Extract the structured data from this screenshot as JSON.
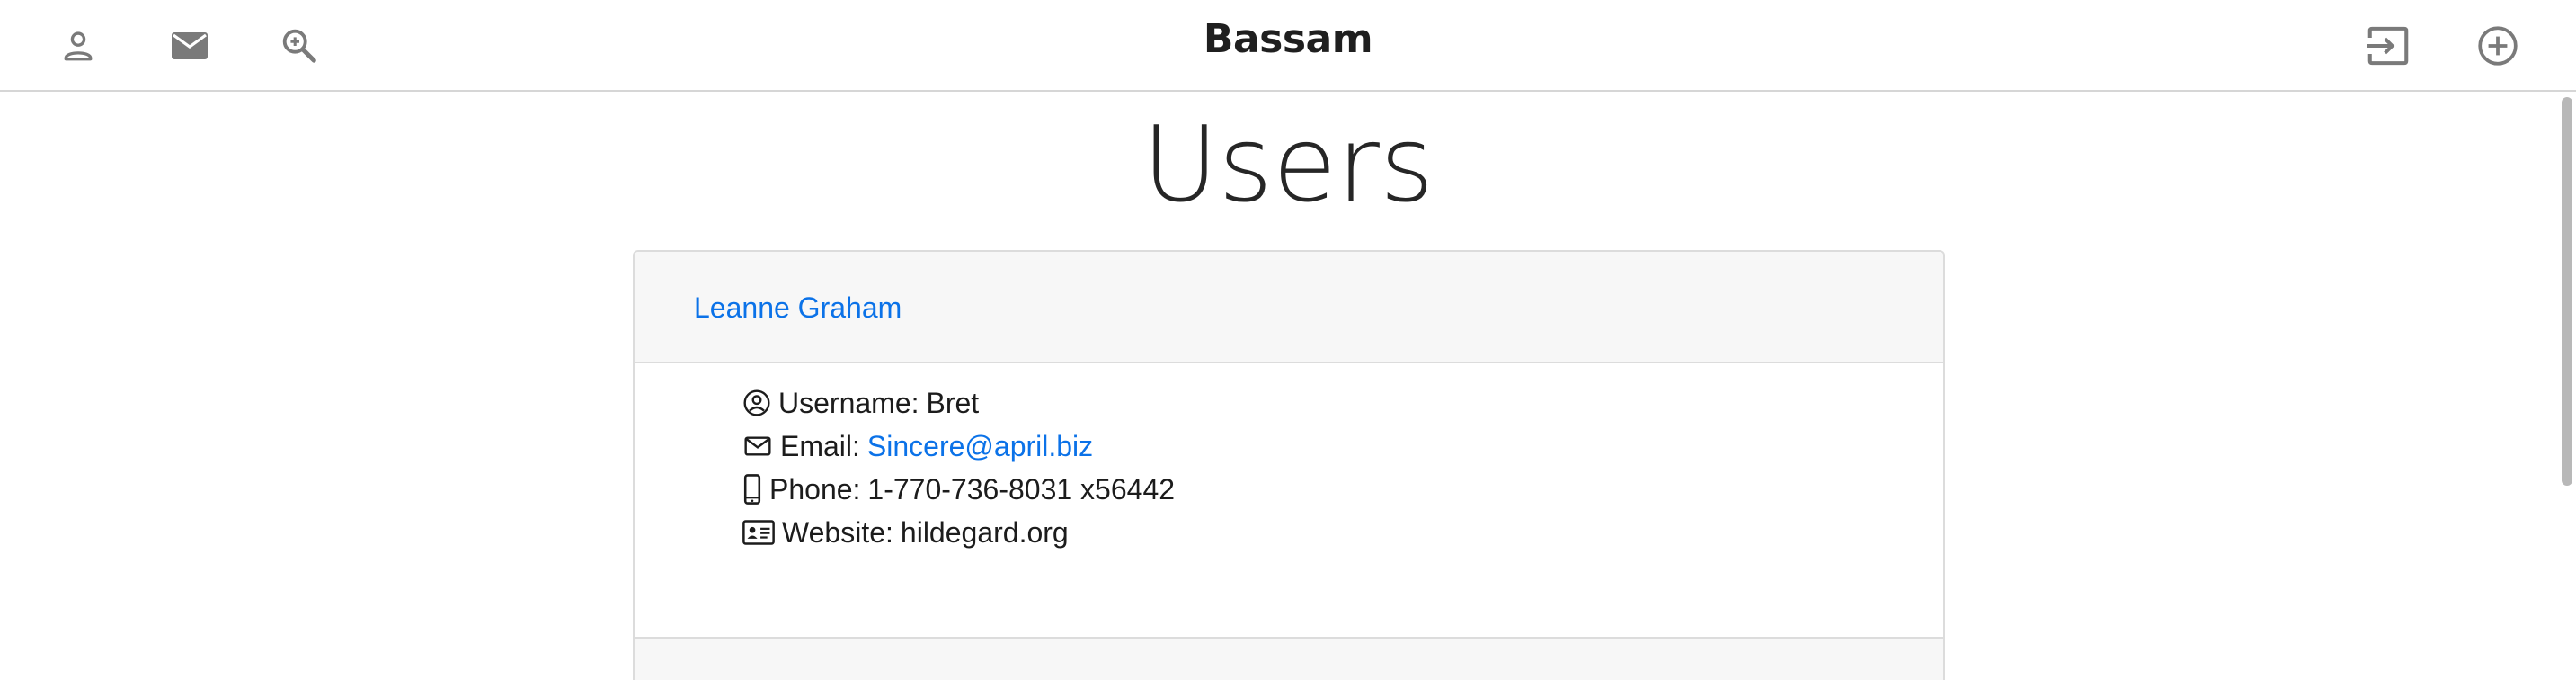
{
  "topbar": {
    "brand": "Bassam",
    "left_icons": [
      "person-icon",
      "mail-icon",
      "zoom-in-icon"
    ],
    "right_icons": [
      "login-icon",
      "add-circle-icon"
    ]
  },
  "main": {
    "title": "Users",
    "users": [
      {
        "name": "Leanne Graham",
        "username_label": "Username:",
        "username": "Bret",
        "email_label": "Email:",
        "email": "Sincere@april.biz",
        "phone_label": "Phone:",
        "phone": "1-770-736-8031 x56442",
        "website_label": "Website:",
        "website": "hildegard.org"
      }
    ]
  },
  "colors": {
    "link": "#0b72e8",
    "icon": "#7a7a7a",
    "card_header_bg": "#f7f7f7",
    "border": "#dcdcdc"
  }
}
